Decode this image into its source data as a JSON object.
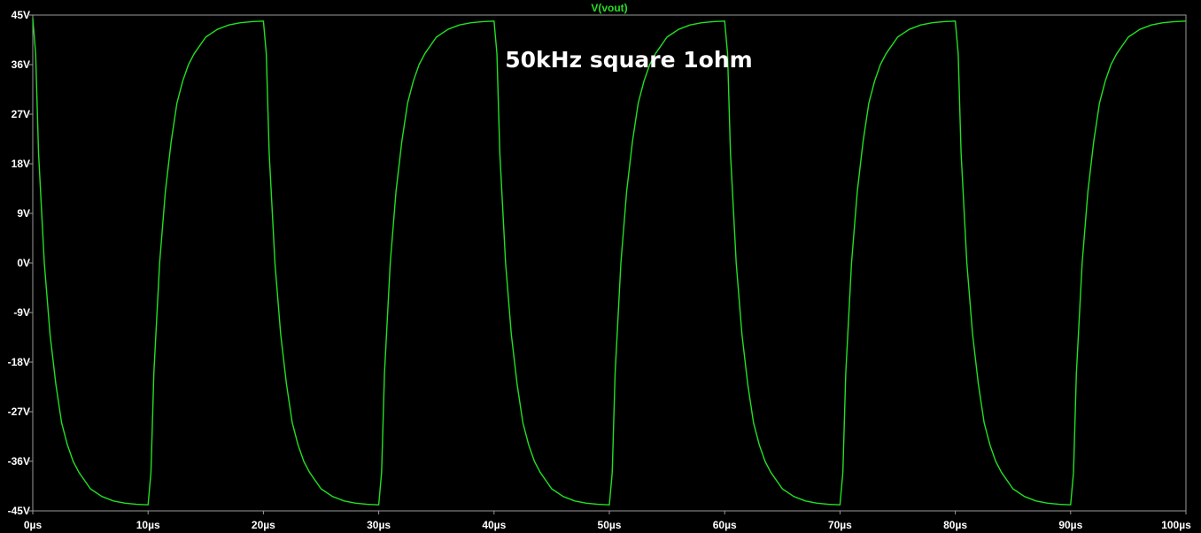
{
  "chart_data": {
    "type": "line",
    "title": "V(vout)",
    "xlabel": "",
    "ylabel": "",
    "annotation": "50kHz square 1ohm",
    "xlim": [
      0,
      100
    ],
    "ylim": [
      -45,
      45
    ],
    "x_unit": "µs",
    "y_unit": "V",
    "x_ticks": [
      "0µs",
      "10µs",
      "20µs",
      "30µs",
      "40µs",
      "50µs",
      "60µs",
      "70µs",
      "80µs",
      "90µs",
      "100µs"
    ],
    "y_ticks": [
      "45V",
      "36V",
      "27V",
      "18V",
      "9V",
      "0V",
      "-9V",
      "-18V",
      "-27V",
      "-36V",
      "-45V"
    ],
    "grid": false,
    "colors": {
      "background": "#000000",
      "trace": "#22e022",
      "axis": "#9a9a9a",
      "text": "#ffffff"
    },
    "series": [
      {
        "name": "V(vout)",
        "x": [
          0,
          0.25,
          0.5,
          1,
          1.5,
          2,
          2.5,
          3,
          3.5,
          4,
          5,
          6,
          7,
          8,
          9,
          10,
          10.25,
          10.5,
          11,
          11.5,
          12,
          12.5,
          13,
          13.5,
          14,
          15,
          16,
          17,
          18,
          19,
          20,
          20.25,
          20.5,
          21,
          21.5,
          22,
          22.5,
          23,
          23.5,
          24,
          25,
          26,
          27,
          28,
          29,
          30,
          30.25,
          30.5,
          31,
          31.5,
          32,
          32.5,
          33,
          33.5,
          34,
          35,
          36,
          37,
          38,
          39,
          40,
          40.25,
          40.5,
          41,
          41.5,
          42,
          42.5,
          43,
          43.5,
          44,
          45,
          46,
          47,
          48,
          49,
          50,
          50.25,
          50.5,
          51,
          51.5,
          52,
          52.5,
          53,
          53.5,
          54,
          55,
          56,
          57,
          58,
          59,
          60,
          60.25,
          60.5,
          61,
          61.5,
          62,
          62.5,
          63,
          63.5,
          64,
          65,
          66,
          67,
          68,
          69,
          70,
          70.25,
          70.5,
          71,
          71.5,
          72,
          72.5,
          73,
          73.5,
          74,
          75,
          76,
          77,
          78,
          79,
          80,
          80.25,
          80.5,
          81,
          81.5,
          82,
          82.5,
          83,
          83.5,
          84,
          85,
          86,
          87,
          88,
          89,
          90,
          90.25,
          90.5,
          91,
          91.5,
          92,
          92.5,
          93,
          93.5,
          94,
          95,
          96,
          97,
          98,
          99,
          100
        ],
        "y": [
          44.4,
          38,
          20,
          0,
          -13,
          -22,
          -29,
          -33,
          -36,
          -38,
          -41,
          -42.4,
          -43.2,
          -43.6,
          -43.8,
          -43.9,
          -38,
          -20,
          0,
          13,
          22,
          29,
          33,
          36,
          38,
          41,
          42.4,
          43.2,
          43.6,
          43.8,
          43.9,
          38,
          20,
          0,
          -13,
          -22,
          -29,
          -33,
          -36,
          -38,
          -41,
          -42.4,
          -43.2,
          -43.6,
          -43.8,
          -43.9,
          -38,
          -20,
          0,
          13,
          22,
          29,
          33,
          36,
          38,
          41,
          42.4,
          43.2,
          43.6,
          43.8,
          43.9,
          38,
          20,
          0,
          -13,
          -22,
          -29,
          -33,
          -36,
          -38,
          -41,
          -42.4,
          -43.2,
          -43.6,
          -43.8,
          -43.9,
          -38,
          -20,
          0,
          13,
          22,
          29,
          33,
          36,
          38,
          41,
          42.4,
          43.2,
          43.6,
          43.8,
          43.9,
          38,
          20,
          0,
          -13,
          -22,
          -29,
          -33,
          -36,
          -38,
          -41,
          -42.4,
          -43.2,
          -43.6,
          -43.8,
          -43.9,
          -38,
          -20,
          0,
          13,
          22,
          29,
          33,
          36,
          38,
          41,
          42.4,
          43.2,
          43.6,
          43.8,
          43.9,
          38,
          20,
          0,
          -13,
          -22,
          -29,
          -33,
          -36,
          -38,
          -41,
          -42.4,
          -43.2,
          -43.6,
          -43.8,
          -43.9,
          -38,
          -20,
          0,
          13,
          22,
          29,
          33,
          36,
          38,
          41,
          42.4,
          43.2,
          43.6,
          43.8,
          43.9
        ]
      }
    ]
  }
}
